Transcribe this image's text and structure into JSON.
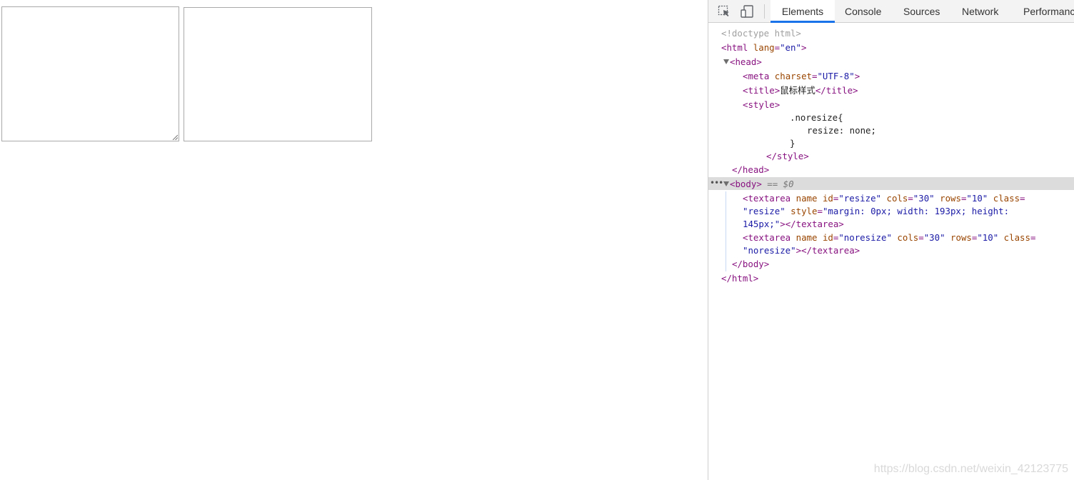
{
  "devtools": {
    "tabs": [
      {
        "label": "Elements",
        "active": true
      },
      {
        "label": "Console",
        "active": false
      },
      {
        "label": "Sources",
        "active": false
      },
      {
        "label": "Network",
        "active": false
      },
      {
        "label": "Performanc",
        "active": false
      }
    ],
    "icons": [
      "inspect-element-icon",
      "device-toolbar-icon"
    ],
    "accent_color": "#1a73e8",
    "dom": {
      "doctype": "<!doctype html>",
      "html_open_tag": "html",
      "html_lang_attr": "lang",
      "html_lang_val": "\"en\"",
      "head_tag": "head",
      "meta_tag": "meta",
      "meta_attr": "charset",
      "meta_val": "\"UTF-8\"",
      "title_tag": "title",
      "title_text": "鼠标样式",
      "title_close": "</title>",
      "style_tag": "style",
      "css_selector": ".noresize{",
      "css_rule": "resize: none;",
      "css_close": "}",
      "style_close": "</style>",
      "head_close": "</head>",
      "body_tag": "body",
      "body_marker": " == ",
      "body_dollar": "$0",
      "ta1_line1_tag": "textarea",
      "ta1_line1_name": "name",
      "ta1_id_attr": "id",
      "ta1_id_val": "\"resize\"",
      "ta1_cols_attr": "cols",
      "ta1_cols_val": "\"30\"",
      "ta1_rows_attr": "rows",
      "ta1_rows_val": "\"10\"",
      "ta1_class_attr": "class",
      "ta1_class_val": "\"resize\"",
      "ta1_style_attr": "style",
      "ta1_style_val_a": "\"margin: 0px; width: 193px; height:",
      "ta1_style_val_b": "145px;\"",
      "ta1_close": "</textarea>",
      "ta2_tag": "textarea",
      "ta2_name": "name",
      "ta2_id_attr": "id",
      "ta2_id_val": "\"noresize\"",
      "ta2_cols_attr": "cols",
      "ta2_cols_val": "\"30\"",
      "ta2_rows_attr": "rows",
      "ta2_rows_val": "\"10\"",
      "ta2_class_attr": "class",
      "ta2_class_val": "\"noresize\"",
      "ta2_close": "</textarea>",
      "body_close": "</body>",
      "html_close": "</html>"
    }
  },
  "watermark": "https://blog.csdn.net/weixin_42123775"
}
